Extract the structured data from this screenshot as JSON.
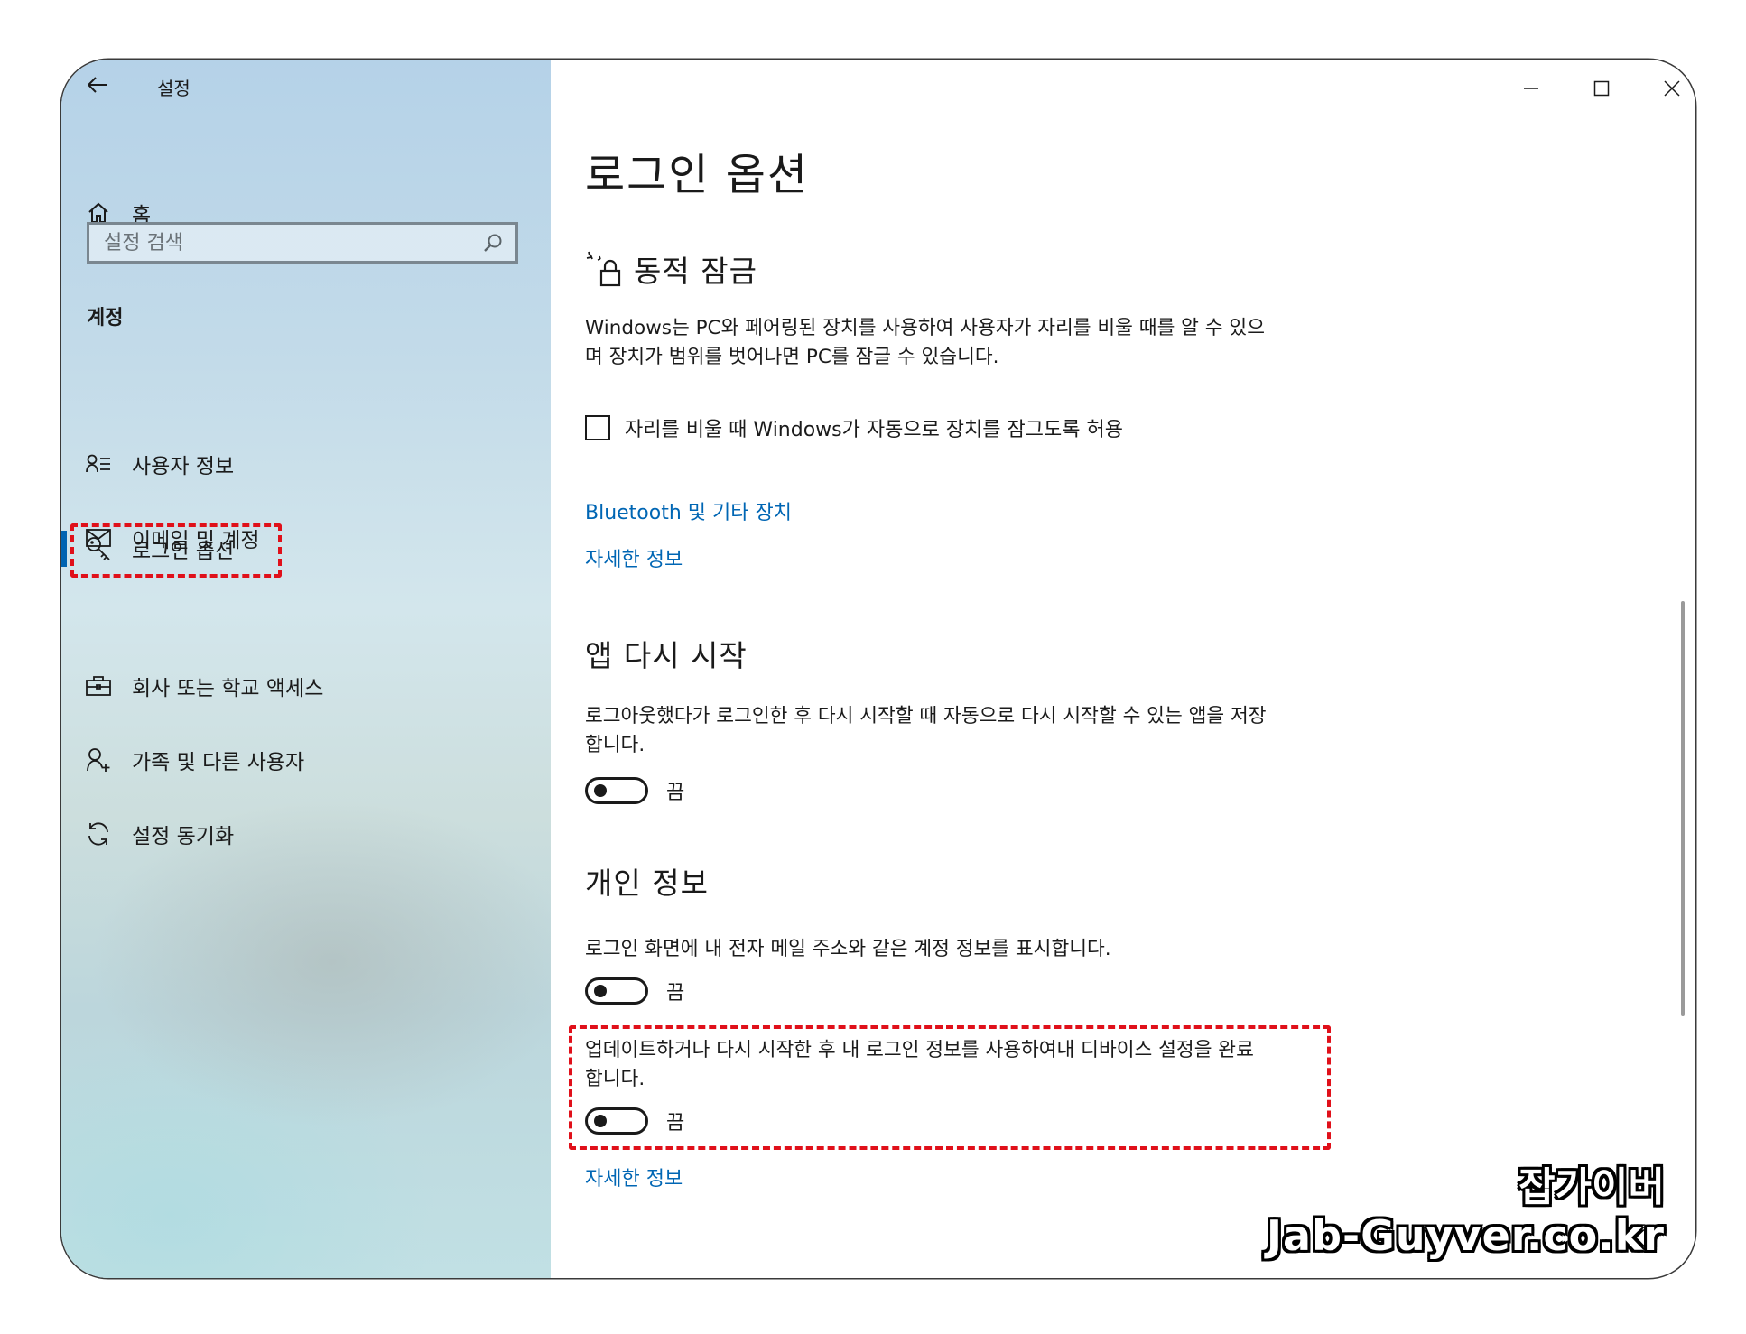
{
  "window": {
    "app_title": "설정"
  },
  "sidebar": {
    "home_label": "홈",
    "search_placeholder": "설정 검색",
    "section_label": "계정",
    "items": [
      {
        "label": "사용자 정보",
        "icon": "user-info-icon"
      },
      {
        "label": "이메일 및 계정",
        "icon": "mail-icon"
      },
      {
        "label": "로그인 옵션",
        "icon": "key-icon",
        "active": true
      },
      {
        "label": "회사 또는 학교 액세스",
        "icon": "briefcase-icon"
      },
      {
        "label": "가족 및 다른 사용자",
        "icon": "add-person-icon"
      },
      {
        "label": "설정 동기화",
        "icon": "sync-icon"
      }
    ]
  },
  "main": {
    "page_title": "로그인 옵션",
    "dynamic_lock": {
      "heading": "동적 잠금",
      "icon": "dynamic-lock-icon",
      "description": "Windows는 PC와 페어링된 장치를 사용하여 사용자가 자리를 비울 때를 알 수 있으며 장치가 범위를 벗어나면 PC를 잠글 수 있습니다.",
      "checkbox_label": "자리를 비울 때 Windows가 자동으로 장치를 잠그도록 허용",
      "checkbox_checked": false,
      "link_bluetooth": "Bluetooth 및 기타 장치",
      "link_more": "자세한 정보"
    },
    "restart_apps": {
      "heading": "앱 다시 시작",
      "description": "로그아웃했다가 로그인한 후 다시 시작할 때 자동으로 다시 시작할 수 있는 앱을 저장합니다.",
      "toggle_state": "끔"
    },
    "privacy": {
      "heading": "개인 정보",
      "show_account_description": "로그인 화면에 내 전자 메일 주소와 같은 계정 정보를 표시합니다.",
      "show_account_toggle": "끔",
      "finish_setup_description": "업데이트하거나 다시 시작한 후 내 로그인 정보를 사용하여내 디바이스 설정을 완료합니다.",
      "finish_setup_toggle": "끔",
      "link_more": "자세한 정보"
    }
  },
  "watermark": {
    "korean": "잡가이버",
    "site": "Jab-Guyver.co.kr"
  },
  "colors": {
    "accent": "#0063b1",
    "link": "#0066b4",
    "highlight": "#e0101a"
  }
}
